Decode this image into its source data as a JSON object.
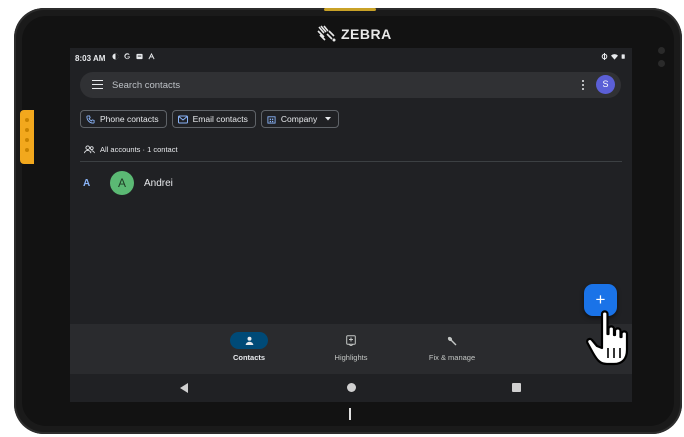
{
  "brand": {
    "logo_text": "ZEBRA"
  },
  "status_bar": {
    "time": "8:03 AM",
    "left_icons": [
      "vpn-icon",
      "google-icon",
      "notification-icon",
      "cast-icon"
    ],
    "right_icons": [
      "sync-icon",
      "wifi-icon",
      "battery-icon"
    ]
  },
  "search": {
    "placeholder": "Search contacts",
    "avatar_letter": "S"
  },
  "filters": {
    "phone": "Phone contacts",
    "email": "Email contacts",
    "company": "Company"
  },
  "accounts": {
    "label": "All accounts · 1 contact"
  },
  "contacts": {
    "section_letter": "A",
    "items": [
      {
        "initial": "A",
        "name": "Andrei"
      }
    ]
  },
  "fab": {
    "symbol": "+"
  },
  "bottom_nav": {
    "items": [
      {
        "label": "Contacts",
        "icon": "person-icon",
        "active": true
      },
      {
        "label": "Highlights",
        "icon": "highlights-icon",
        "active": false
      },
      {
        "label": "Fix & manage",
        "icon": "wrench-icon",
        "active": false
      }
    ]
  },
  "colors": {
    "accent": "#1a73e8",
    "active_pill": "#004a77",
    "avatar_green": "#5bb974",
    "avatar_purple": "#5b5fd6",
    "side_button": "#f2a81d"
  }
}
